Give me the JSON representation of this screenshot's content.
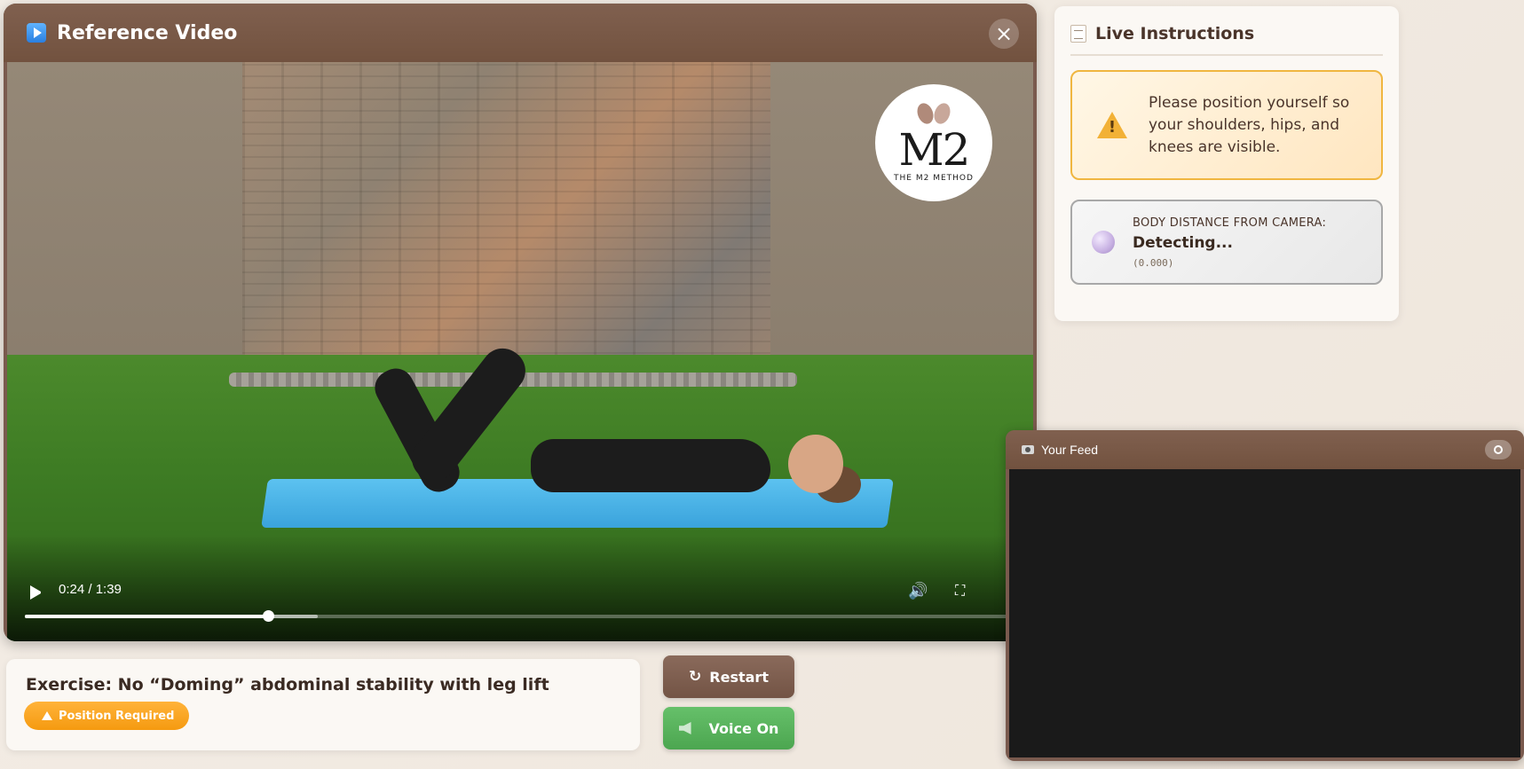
{
  "reference": {
    "title": "Reference Video",
    "close_icon": "×",
    "logo_main": "M2",
    "logo_sub": "THE M2 METHOD",
    "time": "0:24 / 1:39",
    "progress": 0.245,
    "buffered": 0.295
  },
  "instructions": {
    "title": "Live Instructions",
    "warning_text": "Please position yourself so your shoulders, hips, and knees are visible.",
    "distance_label": "BODY DISTANCE FROM CAMERA:",
    "distance_status": "Detecting...",
    "distance_value": "(0.000)"
  },
  "exercise": {
    "title": "Exercise: No “Doming” abdominal stability with leg lift",
    "badge": "Position Required"
  },
  "buttons": {
    "restart": "Restart",
    "restart_icon": "↻",
    "voice": "Voice On"
  },
  "feed": {
    "title": "Your Feed"
  },
  "colors": {
    "header_brown": "#7a5a4e",
    "warning_border": "#f0b640",
    "badge_orange": "#f59a10",
    "voice_green": "#4ca650"
  },
  "icons": [
    "play-badge-icon",
    "close-icon",
    "play-icon",
    "volume-icon",
    "fullscreen-icon",
    "notepad-icon",
    "warning-icon",
    "orb-icon",
    "restart-icon",
    "speaker-icon",
    "camera-icon",
    "toggle-icon"
  ]
}
